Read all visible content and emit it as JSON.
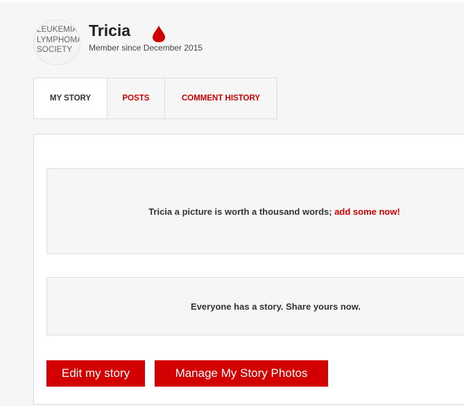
{
  "profile": {
    "avatar_lines": [
      "LEUKEMIA",
      "LYMPHOMA",
      "SOCIETY"
    ],
    "name": "Tricia",
    "member_since": "Member since December 2015",
    "badge_icon": "blood-drop-icon",
    "badge_color": "#cc0000"
  },
  "tabs": [
    {
      "label": "MY STORY",
      "active": true
    },
    {
      "label": "POSTS",
      "active": false
    },
    {
      "label": "COMMENT HISTORY",
      "active": false
    }
  ],
  "photos_prompt": {
    "text": "Tricia a picture is worth a thousand words; ",
    "link": "add some now!"
  },
  "story_prompt": {
    "text": "Everyone has a story. Share yours now."
  },
  "buttons": {
    "edit_story": "Edit my story",
    "manage_photos": "Manage My Story Photos"
  },
  "colors": {
    "accent": "#cc0000",
    "button_bg": "#d20000",
    "page_bg": "#f6f6f6",
    "panel_bg": "#ffffff"
  }
}
